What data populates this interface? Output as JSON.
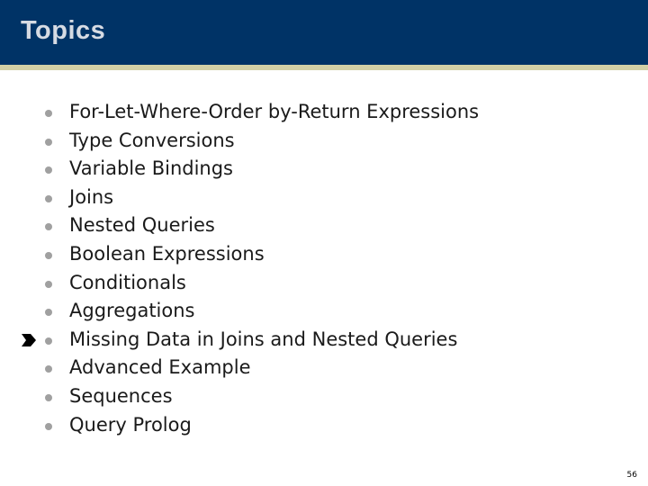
{
  "header": {
    "title": "Topics"
  },
  "topics": [
    {
      "label": "For-Let-Where-Order by-Return Expressions",
      "current": false
    },
    {
      "label": "Type Conversions",
      "current": false
    },
    {
      "label": "Variable Bindings",
      "current": false
    },
    {
      "label": "Joins",
      "current": false
    },
    {
      "label": "Nested Queries",
      "current": false
    },
    {
      "label": "Boolean Expressions",
      "current": false
    },
    {
      "label": "Conditionals",
      "current": false
    },
    {
      "label": "Aggregations",
      "current": false
    },
    {
      "label": "Missing Data in Joins and Nested Queries",
      "current": true
    },
    {
      "label": "Advanced Example",
      "current": false
    },
    {
      "label": "Sequences",
      "current": false
    },
    {
      "label": "Query Prolog",
      "current": false
    }
  ],
  "icons": {
    "bullet": "bullet-dot-icon",
    "current_marker": "arrow-pointer-icon"
  },
  "colors": {
    "header_bg": "#003366",
    "header_rule": "#d2d0a6",
    "title_text": "#d6dbe3",
    "bullet": "#a0a0a0"
  },
  "footer": {
    "page_number": "56"
  }
}
